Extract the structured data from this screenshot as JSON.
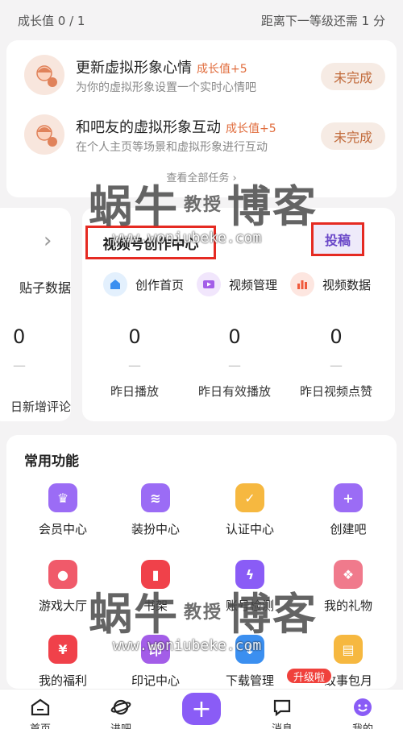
{
  "top_bar": {
    "growth": "成长值 0 / 1",
    "next_level": "距离下一等级还需 1 分"
  },
  "tasks": [
    {
      "title": "更新虚拟形象心情",
      "reward": "成长值+5",
      "desc": "为你的虚拟形象设置一个实时心情吧",
      "button": "未完成"
    },
    {
      "title": "和吧友的虚拟形象互动",
      "reward": "成长值+5",
      "desc": "在个人主页等场景和虚拟形象进行互动",
      "button": "未完成"
    }
  ],
  "view_all": "查看全部任务 ›",
  "left_card": {
    "label": "贴子数据",
    "value": "0",
    "dash": "—",
    "stat_label": "日新增评论"
  },
  "creator": {
    "title": "视频号创作中心",
    "submit": "投稿",
    "shortcuts": [
      {
        "label": "创作首页",
        "icon": "home-icon",
        "color": "#3b8ff0"
      },
      {
        "label": "视频管理",
        "icon": "video-icon",
        "color": "#a35de8"
      },
      {
        "label": "视频数据",
        "icon": "bar-chart-icon",
        "color": "#f05a3c"
      }
    ],
    "stats": [
      {
        "value": "0",
        "dash": "—",
        "label": "昨日播放"
      },
      {
        "value": "0",
        "dash": "—",
        "label": "昨日有效播放"
      },
      {
        "value": "0",
        "dash": "—",
        "label": "昨日视频点赞"
      }
    ]
  },
  "functions": {
    "title": "常用功能",
    "items": [
      {
        "label": "会员中心",
        "icon": "crown-icon",
        "color": "#9b6cf5",
        "glyph": "♛"
      },
      {
        "label": "装扮中心",
        "icon": "wardrobe-icon",
        "color": "#9b6cf5",
        "glyph": "≋"
      },
      {
        "label": "认证中心",
        "icon": "badge-check-icon",
        "color": "#f6b840",
        "glyph": "✓"
      },
      {
        "label": "创建吧",
        "icon": "plus-icon",
        "color": "#9b6cf5",
        "glyph": "+"
      },
      {
        "label": "游戏大厅",
        "icon": "gamepad-icon",
        "color": "#f05a6a",
        "glyph": "●"
      },
      {
        "label": "书架",
        "icon": "bookmark-icon",
        "color": "#f0414a",
        "glyph": "▮"
      },
      {
        "label": "账号检测",
        "icon": "shield-icon",
        "color": "#8a5cf6",
        "glyph": "ϟ"
      },
      {
        "label": "我的礼物",
        "icon": "gift-icon",
        "color": "#f07a8c",
        "glyph": "❖"
      },
      {
        "label": "我的福利",
        "icon": "coin-bag-icon",
        "color": "#f0414a",
        "glyph": "¥"
      },
      {
        "label": "印记中心",
        "icon": "stamp-icon",
        "color": "#a35de8",
        "glyph": "印"
      },
      {
        "label": "下载管理",
        "icon": "download-icon",
        "color": "#3b8ff0",
        "glyph": "↓"
      },
      {
        "label": "故事包月",
        "icon": "story-icon",
        "color": "#f6b840",
        "glyph": "▤"
      }
    ]
  },
  "nav": {
    "items": [
      {
        "label": "首页",
        "icon": "home-icon"
      },
      {
        "label": "进吧",
        "icon": "planet-icon"
      },
      {
        "label": "",
        "icon": "plus-icon"
      },
      {
        "label": "消息",
        "icon": "chat-icon"
      },
      {
        "label": "我的",
        "icon": "smile-icon"
      }
    ],
    "badge": "升级啦"
  },
  "watermark": {
    "cn_left": "蜗牛",
    "cn_mid": "教授",
    "cn_right": "博客",
    "url": "www.woniubeke.com"
  }
}
